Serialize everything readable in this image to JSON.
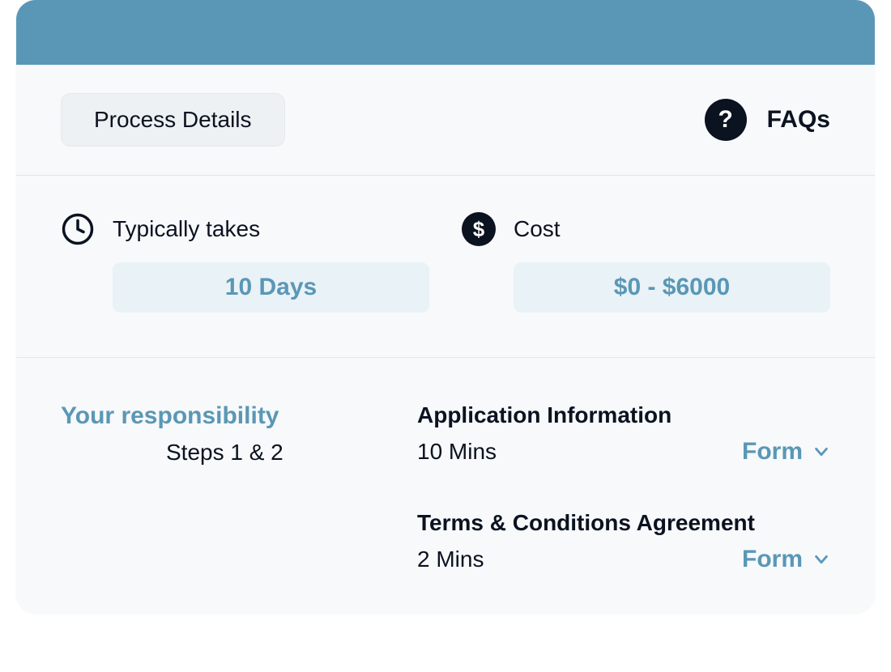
{
  "tabs": {
    "process_details_label": "Process Details",
    "faqs_label": "FAQs"
  },
  "summary": {
    "takes_label": "Typically takes",
    "takes_value": "10 Days",
    "cost_label": "Cost",
    "cost_value": "$0 - $6000"
  },
  "responsibility": {
    "title": "Your responsibility",
    "subtitle": "Steps 1 & 2"
  },
  "steps": [
    {
      "title": "Application Information",
      "time": "10 Mins",
      "action_label": "Form"
    },
    {
      "title": "Terms & Conditions Agreement",
      "time": "2 Mins",
      "action_label": "Form"
    }
  ]
}
